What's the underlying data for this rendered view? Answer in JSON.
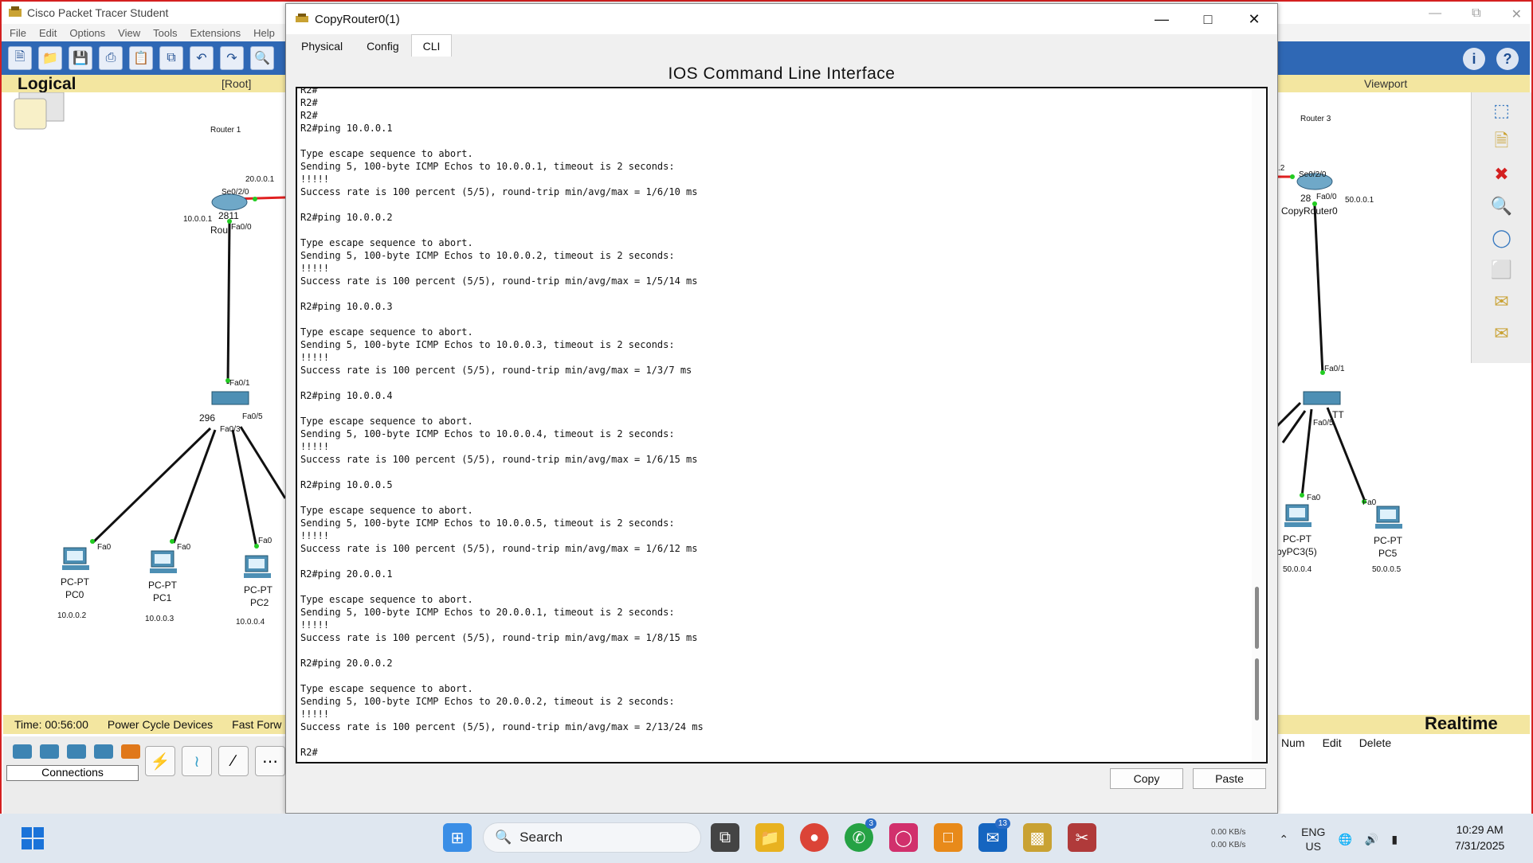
{
  "app": {
    "title": "Cisco Packet Tracer Student",
    "menu": [
      "File",
      "Edit",
      "Options",
      "View",
      "Tools",
      "Extensions",
      "Help"
    ],
    "logical_label": "Logical",
    "root_label": "[Root]",
    "viewport_label": "Viewport",
    "status": {
      "time": "Time: 00:56:00",
      "power_cycle": "Power Cycle Devices",
      "fast_forward": "Fast Forw"
    },
    "connections_label": "Connections",
    "realtime_label": "Realtime",
    "pdu_columns": [
      "Num",
      "Edit",
      "Delete"
    ]
  },
  "topology_left": {
    "router1_title": "Router 1",
    "router1_port_serial": "Se0/2/0",
    "router1_ip_serial": "20.0.0.1",
    "router1_ip_lan": "10.0.0.1",
    "router1_model": "2811",
    "router1_name": "Rou",
    "router1_port_fa": "Fa0/0",
    "switch_port_fa01": "Fa0/1",
    "switch_port_fa05": "Fa0/5",
    "switch_port_fa03": "Fa0/3",
    "switch_model": "296",
    "pcs": [
      {
        "type": "PC-PT",
        "name": "PC0",
        "ip": "10.0.0.2",
        "port": "Fa0"
      },
      {
        "type": "PC-PT",
        "name": "PC1",
        "ip": "10.0.0.3",
        "port": "Fa0"
      },
      {
        "type": "PC-PT",
        "name": "PC2",
        "ip": "10.0.0.4",
        "port": "Fa0"
      }
    ]
  },
  "topology_right": {
    "router3_title": "Router 3",
    "router3_port_serial": "Se0/2/0",
    "router3_port_fa": "Fa0/0",
    "router3_ip": "50.0.0.1",
    "router3_model": "28",
    "router3_name": "CopyRouter0",
    "link_label": ".2",
    "switch_port_fa01": "Fa0/1",
    "switch_tt": "TT",
    "switch_port_fa05": "Fa0/5",
    "pcs": [
      {
        "type": "PC-PT",
        "name": "pyPC3(5)",
        "ip": "50.0.0.4",
        "port": "Fa0"
      },
      {
        "type": "PC-PT",
        "name": "PC5",
        "ip": "50.0.0.5",
        "port": "Fa0"
      }
    ]
  },
  "dialog": {
    "title": "CopyRouter0(1)",
    "tabs": [
      "Physical",
      "Config",
      "CLI"
    ],
    "active_tab": "CLI",
    "heading": "IOS Command Line Interface",
    "copy_button": "Copy",
    "paste_button": "Paste",
    "terminal_lines": [
      "R2#",
      "R2#",
      "R2#",
      "R2#ping 10.0.0.1",
      "",
      "Type escape sequence to abort.",
      "Sending 5, 100-byte ICMP Echos to 10.0.0.1, timeout is 2 seconds:",
      "!!!!!",
      "Success rate is 100 percent (5/5), round-trip min/avg/max = 1/6/10 ms",
      "",
      "R2#ping 10.0.0.2",
      "",
      "Type escape sequence to abort.",
      "Sending 5, 100-byte ICMP Echos to 10.0.0.2, timeout is 2 seconds:",
      "!!!!!",
      "Success rate is 100 percent (5/5), round-trip min/avg/max = 1/5/14 ms",
      "",
      "R2#ping 10.0.0.3",
      "",
      "Type escape sequence to abort.",
      "Sending 5, 100-byte ICMP Echos to 10.0.0.3, timeout is 2 seconds:",
      "!!!!!",
      "Success rate is 100 percent (5/5), round-trip min/avg/max = 1/3/7 ms",
      "",
      "R2#ping 10.0.0.4",
      "",
      "Type escape sequence to abort.",
      "Sending 5, 100-byte ICMP Echos to 10.0.0.4, timeout is 2 seconds:",
      "!!!!!",
      "Success rate is 100 percent (5/5), round-trip min/avg/max = 1/6/15 ms",
      "",
      "R2#ping 10.0.0.5",
      "",
      "Type escape sequence to abort.",
      "Sending 5, 100-byte ICMP Echos to 10.0.0.5, timeout is 2 seconds:",
      "!!!!!",
      "Success rate is 100 percent (5/5), round-trip min/avg/max = 1/6/12 ms",
      "",
      "R2#ping 20.0.0.1",
      "",
      "Type escape sequence to abort.",
      "Sending 5, 100-byte ICMP Echos to 20.0.0.1, timeout is 2 seconds:",
      "!!!!!",
      "Success rate is 100 percent (5/5), round-trip min/avg/max = 1/8/15 ms",
      "",
      "R2#ping 20.0.0.2",
      "",
      "Type escape sequence to abort.",
      "Sending 5, 100-byte ICMP Echos to 20.0.0.2, timeout is 2 seconds:",
      "!!!!!",
      "Success rate is 100 percent (5/5), round-trip min/avg/max = 2/13/24 ms",
      "",
      "R2#"
    ]
  },
  "taskbar": {
    "search_placeholder": "Search",
    "whatsapp_badge": "3",
    "outlook_badge": "13",
    "net_up": "0.00 KB/s",
    "net_down": "0.00 KB/s",
    "lang_line1": "ENG",
    "lang_line2": "US",
    "time": "10:29 AM",
    "date": "7/31/2025"
  },
  "colors": {
    "toolbar_blue": "#2f68b5",
    "logical_bar": "#f3e6a0",
    "link_red": "#e02020",
    "link_black": "#111111",
    "port_green": "#22cc22",
    "window_border_red": "#d42020"
  }
}
